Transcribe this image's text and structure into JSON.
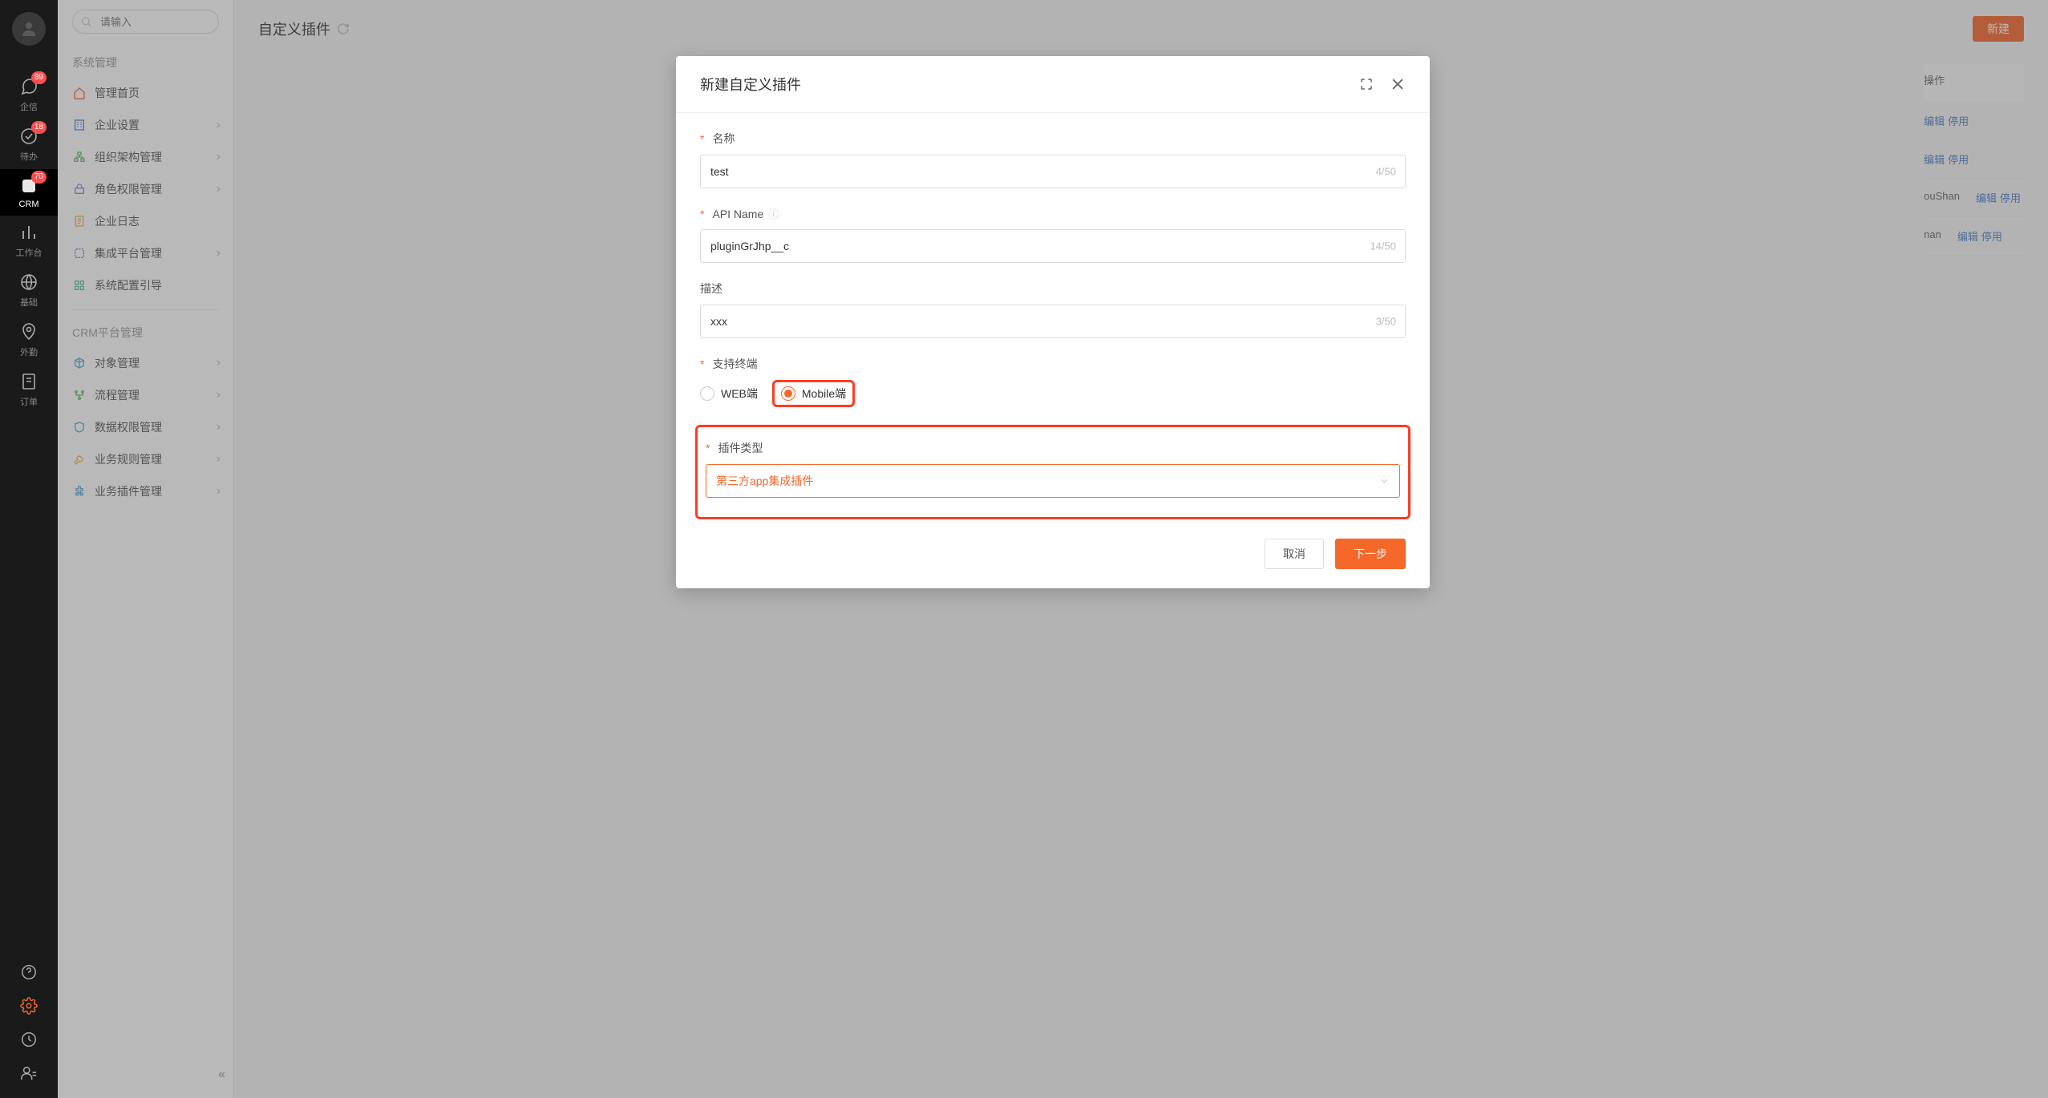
{
  "nav": {
    "items": [
      {
        "label": "企信",
        "badge": "89"
      },
      {
        "label": "待办",
        "badge": "18"
      },
      {
        "label": "CRM",
        "badge": "70"
      },
      {
        "label": "工作台",
        "badge": ""
      },
      {
        "label": "基础",
        "badge": ""
      },
      {
        "label": "外勤",
        "badge": ""
      },
      {
        "label": "订单",
        "badge": ""
      }
    ]
  },
  "sidebar": {
    "search_placeholder": "请输入",
    "section1_title": "系统管理",
    "section1_items": [
      "管理首页",
      "企业设置",
      "组织架构管理",
      "角色权限管理",
      "企业日志",
      "集成平台管理",
      "系统配置引导"
    ],
    "section2_title": "CRM平台管理",
    "section2_items": [
      "对象管理",
      "流程管理",
      "数据权限管理",
      "业务规则管理",
      "业务插件管理"
    ]
  },
  "main": {
    "title": "自定义插件",
    "new_button": "新建",
    "table_op_header": "操作",
    "op_edit": "编辑",
    "op_disable": "停用",
    "row3_suffix": "ouShan",
    "row4_suffix": "nan"
  },
  "modal": {
    "title": "新建自定义插件",
    "name_label": "名称",
    "name_value": "test",
    "name_counter": "4/50",
    "api_label": "API Name",
    "api_value": "pluginGrJhp__c",
    "api_counter": "14/50",
    "desc_label": "描述",
    "desc_value": "xxx",
    "desc_counter": "3/50",
    "terminal_label": "支持终端",
    "terminal_web": "WEB端",
    "terminal_mobile": "Mobile端",
    "plugin_type_label": "插件类型",
    "plugin_type_value": "第三方app集成插件",
    "cancel": "取消",
    "next": "下一步"
  }
}
